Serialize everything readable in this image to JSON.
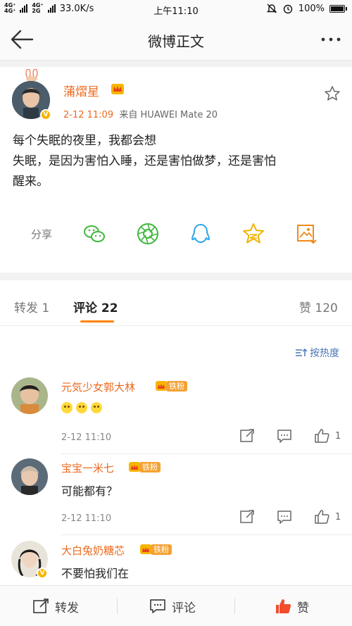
{
  "status_bar": {
    "network_left": "4G⁺",
    "network_left2": "4G⁺",
    "network_2g": "2G",
    "speed": "33.0K/s",
    "time": "上午11:10",
    "battery": "100%"
  },
  "nav": {
    "title": "微博正文"
  },
  "post": {
    "author": "蒲熠星",
    "time": "2-12 11:09",
    "source_prefix": "来自",
    "source": "HUAWEI Mate 20",
    "lines": [
      "每个失眠的夜里，我都会想",
      "失眠，是因为害怕入睡，还是害怕做梦，还是害怕",
      "醒来。"
    ],
    "share_label": "分享"
  },
  "tabs": {
    "repost": "转发 1",
    "comments": "评论 22",
    "likes": "赞 120"
  },
  "sort_label": "按热度",
  "comments": [
    {
      "name": "元気少女郭大林",
      "badge": "铁粉",
      "text": "",
      "emoji_count": 3,
      "time": "2-12 11:10",
      "likes": "1"
    },
    {
      "name": "宝宝一米七",
      "badge": "铁粉",
      "text": "可能都有？",
      "emoji_count": 0,
      "time": "2-12 11:10",
      "likes": "1"
    },
    {
      "name": "大白兔奶糖芯",
      "badge": "铁粉",
      "text": "不要怕我们在",
      "emoji_count": 0,
      "time": "",
      "likes": ""
    }
  ],
  "bottom": {
    "repost": "转发",
    "comment": "评论",
    "like": "赞"
  },
  "colors": {
    "accent_orange": "#ff8200",
    "name_orange": "#ec6a1f",
    "link_blue": "#4a76b6",
    "badge_gold": "#f7b500"
  }
}
